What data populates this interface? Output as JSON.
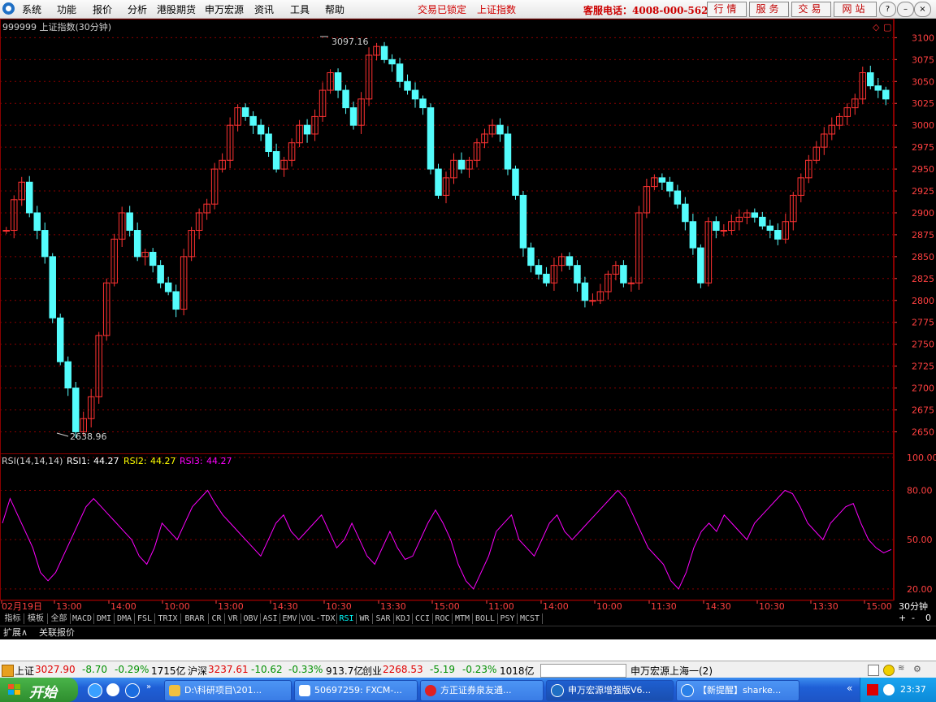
{
  "menu": {
    "items": [
      "系统",
      "功能",
      "报价",
      "分析",
      "港股期货",
      "申万宏源",
      "资讯",
      "工具",
      "帮助"
    ],
    "lock_status": "交易已锁定",
    "index_link": "上证指数",
    "hotline": "客服电话：4008-000-562",
    "buttons": [
      "行情",
      "服务",
      "交易",
      "网站"
    ]
  },
  "chart_header": {
    "title": "999999 上证指数(30分钟)"
  },
  "colors": {
    "up": "#ff3232",
    "down": "#54fcfc",
    "grid": "#8a0000",
    "axis_text": "#ff4040",
    "rsi": "#ff00ff"
  },
  "price_labels": {
    "high": "3097.16",
    "low": "2638.96"
  },
  "price_axis": {
    "min": 2630,
    "max": 3105,
    "ticks": [
      "3100",
      "3075",
      "3050",
      "3025",
      "3000",
      "2975",
      "2950",
      "2925",
      "2900",
      "2875",
      "2850",
      "2825",
      "2800",
      "2775",
      "2750",
      "2725",
      "2700",
      "2675",
      "2650"
    ]
  },
  "rsi_legend": {
    "params": "RSI(14,14,14)",
    "rsi1_label": "RSI1:",
    "rsi1_value": "44.27",
    "rsi2_label": "RSI2:",
    "rsi2_value": "44.27",
    "rsi3_label": "RSI3:",
    "rsi3_value": "44.27"
  },
  "rsi_axis": {
    "ticks": [
      "100.00",
      "80.00",
      "50.00",
      "20.00"
    ]
  },
  "time_axis": {
    "labels": [
      "02月19日",
      "13:00",
      "14:00",
      "10:00",
      "13:00",
      "14:30",
      "10:30",
      "13:30",
      "15:00",
      "11:00",
      "14:00",
      "10:00",
      "11:30",
      "14:30",
      "10:30",
      "13:30",
      "15:00"
    ],
    "period": "30分钟"
  },
  "chart_data": [
    {
      "type": "candlestick",
      "title": "999999 上证指数(30分钟)",
      "ylim": [
        2630,
        3105
      ],
      "high_label": 3097.16,
      "low_label": 2638.96,
      "close_points": [
        2880,
        2915,
        2935,
        2900,
        2880,
        2850,
        2780,
        2730,
        2700,
        2650,
        2665,
        2690,
        2760,
        2820,
        2870,
        2900,
        2880,
        2850,
        2855,
        2840,
        2820,
        2810,
        2790,
        2850,
        2880,
        2900,
        2910,
        2950,
        2960,
        3000,
        3020,
        3010,
        3000,
        2990,
        2970,
        2950,
        2960,
        2980,
        3000,
        2990,
        3010,
        3040,
        3060,
        3040,
        3020,
        3000,
        3030,
        3080,
        3090,
        3075,
        3070,
        3050,
        3040,
        3030,
        3020,
        2950,
        2920,
        2940,
        2960,
        2950,
        2960,
        2980,
        2990,
        3000,
        2990,
        2950,
        2920,
        2860,
        2840,
        2830,
        2820,
        2840,
        2850,
        2840,
        2820,
        2800,
        2800,
        2810,
        2830,
        2840,
        2820,
        2820,
        2900,
        2930,
        2940,
        2935,
        2925,
        2910,
        2890,
        2860,
        2820,
        2890,
        2880,
        2880,
        2890,
        2895,
        2900,
        2895,
        2885,
        2880,
        2870,
        2890,
        2920,
        2940,
        2960,
        2975,
        2990,
        3000,
        3010,
        3020,
        3030,
        3060,
        3045,
        3040,
        3030
      ]
    },
    {
      "type": "line",
      "title": "RSI(14,14,14)",
      "series": [
        {
          "name": "RSI3",
          "values": [
            60,
            75,
            65,
            55,
            45,
            30,
            25,
            30,
            40,
            50,
            60,
            70,
            75,
            70,
            65,
            60,
            55,
            50,
            40,
            35,
            45,
            60,
            55,
            50,
            60,
            70,
            75,
            80,
            72,
            65,
            60,
            55,
            50,
            45,
            40,
            50,
            60,
            65,
            55,
            50,
            55,
            60,
            65,
            55,
            45,
            50,
            60,
            50,
            40,
            35,
            45,
            55,
            45,
            38,
            40,
            50,
            60,
            68,
            60,
            50,
            35,
            25,
            20,
            30,
            40,
            55,
            60,
            65,
            50,
            45,
            40,
            50,
            60,
            65,
            55,
            50,
            55,
            60,
            65,
            70,
            75,
            80,
            75,
            65,
            55,
            45,
            40,
            35,
            25,
            20,
            30,
            45,
            55,
            60,
            55,
            65,
            60,
            55,
            50,
            60,
            65,
            70,
            75,
            80,
            78,
            70,
            60,
            55,
            50,
            60,
            65,
            70,
            72,
            60,
            50,
            45,
            42,
            44
          ]
        }
      ],
      "ylim": [
        15,
        100
      ]
    }
  ],
  "indicator_tabs": [
    "指标",
    "模板",
    "全部",
    "MACD",
    "DMI",
    "DMA",
    "FSL",
    "TRIX",
    "BRAR",
    "CR",
    "VR",
    "OBV",
    "ASI",
    "EMV",
    "VOL-TDX",
    "RSI",
    "WR",
    "SAR",
    "KDJ",
    "CCI",
    "ROC",
    "MTM",
    "BOLL",
    "PSY",
    "MCST"
  ],
  "extension_tabs": [
    "扩展∧",
    "关联报价"
  ],
  "status_bar": {
    "sh_label": "上证",
    "sh_value": "3027.90",
    "sh_change": "-8.70",
    "sh_pct": "-0.29%",
    "sh_amount": "1715亿",
    "hs_label": "沪深",
    "hs_value": "3237.61",
    "hs_change": "-10.62",
    "hs_pct": "-0.33%",
    "hs_amount": "913.7亿",
    "cy_label": "创业",
    "cy_value": "2268.53",
    "cy_change": "-5.19",
    "cy_pct": "-0.23%",
    "cy_amount": "1018亿",
    "server": "申万宏源上海一(2)"
  },
  "taskbar": {
    "start_label": "开始",
    "items": [
      "D:\\科研项目\\201...",
      "50697259: FXCM-...",
      "方正证券泉友通...",
      "申万宏源增强版V6...",
      "【新提醒】sharke..."
    ],
    "clock": "23:37"
  }
}
